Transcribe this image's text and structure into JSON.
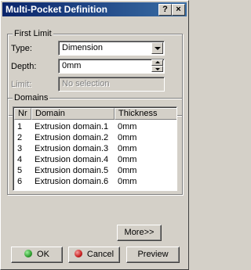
{
  "window": {
    "title": "Multi-Pocket Definition",
    "help_glyph": "?",
    "close_glyph": "×"
  },
  "first_limit": {
    "legend": "First Limit",
    "type_label": "Type:",
    "type_value": "Dimension",
    "depth_label": "Depth:",
    "depth_value": "0mm",
    "limit_label": "Limit:",
    "limit_placeholder": "No selection"
  },
  "domains": {
    "legend": "Domains",
    "columns": [
      "Nr",
      "Domain",
      "Thickness"
    ],
    "rows": [
      {
        "nr": "1",
        "domain": "Extrusion domain.1",
        "thickness": "0mm"
      },
      {
        "nr": "2",
        "domain": "Extrusion domain.2",
        "thickness": "0mm"
      },
      {
        "nr": "3",
        "domain": "Extrusion domain.3",
        "thickness": "0mm"
      },
      {
        "nr": "4",
        "domain": "Extrusion domain.4",
        "thickness": "0mm"
      },
      {
        "nr": "5",
        "domain": "Extrusion domain.5",
        "thickness": "0mm"
      },
      {
        "nr": "6",
        "domain": "Extrusion domain.6",
        "thickness": "0mm"
      }
    ]
  },
  "buttons": {
    "more": "More>>",
    "ok": "OK",
    "cancel": "Cancel",
    "preview": "Preview"
  },
  "colors": {
    "ok_icon": "#2e9e2e",
    "cancel_icon": "#c81e1e",
    "title_bar": "#0a246a"
  }
}
